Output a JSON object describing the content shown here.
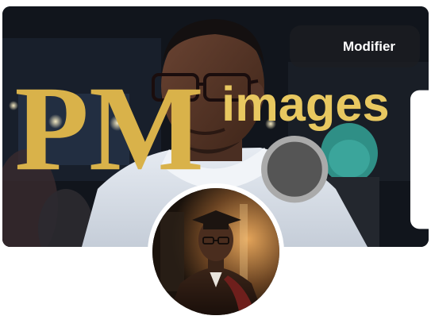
{
  "cover": {
    "edit_button_label": "Modifier",
    "edit_button_icon": "camera-icon",
    "watermark_text": "PM",
    "watermark_subtext": "images"
  },
  "avatar": {
    "icon": "profile-photo"
  },
  "colors": {
    "button_bg": "#1c1e21",
    "button_text": "#ffffff",
    "page_bg": "#ffffff"
  }
}
